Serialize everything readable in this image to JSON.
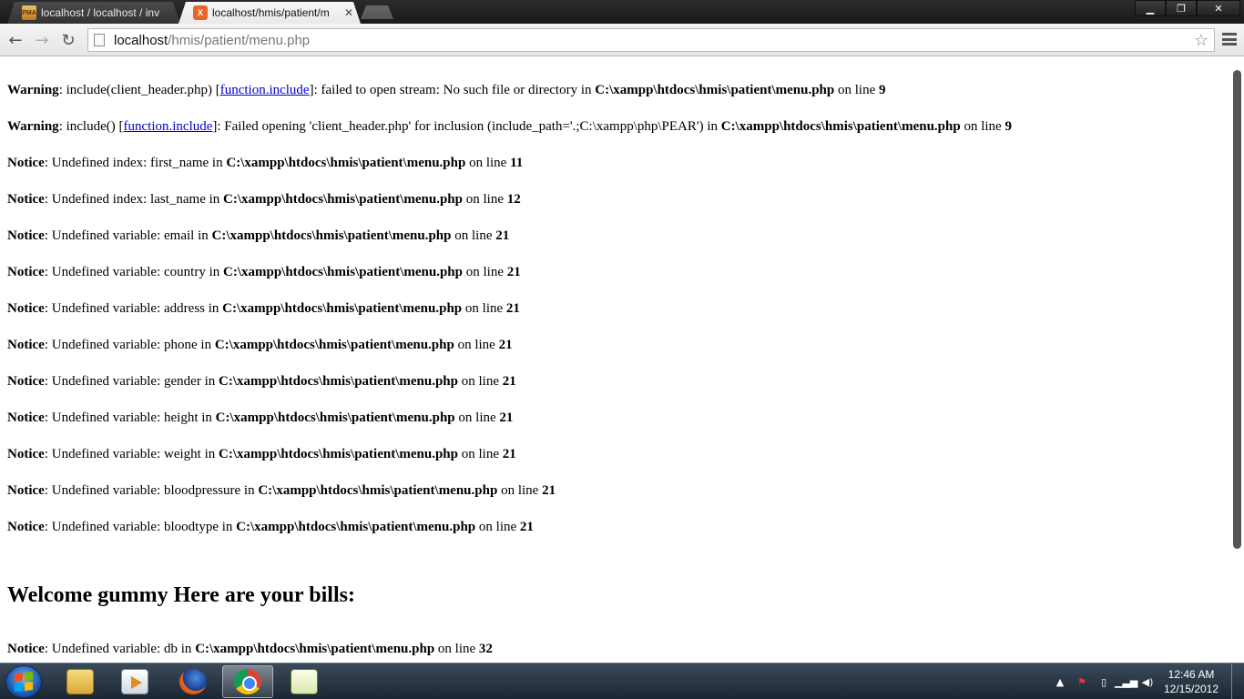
{
  "browser": {
    "tabs": [
      {
        "label": "localhost / localhost / inv",
        "favicon": "phpmyadmin-icon",
        "favicon_text": "PMA",
        "active": false
      },
      {
        "label": "localhost/hmis/patient/m",
        "favicon": "xampp-icon",
        "favicon_text": "X",
        "active": true
      }
    ],
    "url_host": "localhost",
    "url_path": "/hmis/patient/menu.php"
  },
  "page": {
    "messages_before": [
      {
        "level": "Warning",
        "parts": [
          {
            "t": ": include(client_header.php) ["
          },
          {
            "link": "function.include"
          },
          {
            "t": "]: failed to open stream: No such file or directory in "
          },
          {
            "b": "C:\\xampp\\htdocs\\hmis\\patient\\menu.php"
          },
          {
            "t": " on line "
          },
          {
            "b": "9"
          }
        ]
      },
      {
        "level": "Warning",
        "parts": [
          {
            "t": ": include() ["
          },
          {
            "link": "function.include"
          },
          {
            "t": "]: Failed opening 'client_header.php' for inclusion (include_path='.;C:\\xampp\\php\\PEAR') in "
          },
          {
            "b": "C:\\xampp\\htdocs\\hmis\\patient\\menu.php"
          },
          {
            "t": " on line "
          },
          {
            "b": "9"
          }
        ]
      },
      {
        "level": "Notice",
        "parts": [
          {
            "t": ": Undefined index: first_name in "
          },
          {
            "b": "C:\\xampp\\htdocs\\hmis\\patient\\menu.php"
          },
          {
            "t": " on line "
          },
          {
            "b": "11"
          }
        ]
      },
      {
        "level": "Notice",
        "parts": [
          {
            "t": ": Undefined index: last_name in "
          },
          {
            "b": "C:\\xampp\\htdocs\\hmis\\patient\\menu.php"
          },
          {
            "t": " on line "
          },
          {
            "b": "12"
          }
        ]
      },
      {
        "level": "Notice",
        "parts": [
          {
            "t": ": Undefined variable: email in "
          },
          {
            "b": "C:\\xampp\\htdocs\\hmis\\patient\\menu.php"
          },
          {
            "t": " on line "
          },
          {
            "b": "21"
          }
        ]
      },
      {
        "level": "Notice",
        "parts": [
          {
            "t": ": Undefined variable: country in "
          },
          {
            "b": "C:\\xampp\\htdocs\\hmis\\patient\\menu.php"
          },
          {
            "t": " on line "
          },
          {
            "b": "21"
          }
        ]
      },
      {
        "level": "Notice",
        "parts": [
          {
            "t": ": Undefined variable: address in "
          },
          {
            "b": "C:\\xampp\\htdocs\\hmis\\patient\\menu.php"
          },
          {
            "t": " on line "
          },
          {
            "b": "21"
          }
        ]
      },
      {
        "level": "Notice",
        "parts": [
          {
            "t": ": Undefined variable: phone in "
          },
          {
            "b": "C:\\xampp\\htdocs\\hmis\\patient\\menu.php"
          },
          {
            "t": " on line "
          },
          {
            "b": "21"
          }
        ]
      },
      {
        "level": "Notice",
        "parts": [
          {
            "t": ": Undefined variable: gender in "
          },
          {
            "b": "C:\\xampp\\htdocs\\hmis\\patient\\menu.php"
          },
          {
            "t": " on line "
          },
          {
            "b": "21"
          }
        ]
      },
      {
        "level": "Notice",
        "parts": [
          {
            "t": ": Undefined variable: height in "
          },
          {
            "b": "C:\\xampp\\htdocs\\hmis\\patient\\menu.php"
          },
          {
            "t": " on line "
          },
          {
            "b": "21"
          }
        ]
      },
      {
        "level": "Notice",
        "parts": [
          {
            "t": ": Undefined variable: weight in "
          },
          {
            "b": "C:\\xampp\\htdocs\\hmis\\patient\\menu.php"
          },
          {
            "t": " on line "
          },
          {
            "b": "21"
          }
        ]
      },
      {
        "level": "Notice",
        "parts": [
          {
            "t": ": Undefined variable: bloodpressure in "
          },
          {
            "b": "C:\\xampp\\htdocs\\hmis\\patient\\menu.php"
          },
          {
            "t": " on line "
          },
          {
            "b": "21"
          }
        ]
      },
      {
        "level": "Notice",
        "parts": [
          {
            "t": ": Undefined variable: bloodtype in "
          },
          {
            "b": "C:\\xampp\\htdocs\\hmis\\patient\\menu.php"
          },
          {
            "t": " on line "
          },
          {
            "b": "21"
          }
        ]
      }
    ],
    "welcome_heading": "Welcome gummy Here are your bills:",
    "messages_after": [
      {
        "level": "Notice",
        "parts": [
          {
            "t": ": Undefined variable: db in "
          },
          {
            "b": "C:\\xampp\\htdocs\\hmis\\patient\\menu.php"
          },
          {
            "t": " on line "
          },
          {
            "b": "32"
          }
        ]
      }
    ]
  },
  "taskbar": {
    "apps": [
      "windows-explorer-icon",
      "media-player-icon",
      "firefox-icon",
      "chrome-icon",
      "notepad-plus-plus-icon"
    ],
    "active_app": "chrome-icon",
    "clock_time": "12:46 AM",
    "clock_date": "12/15/2012"
  }
}
